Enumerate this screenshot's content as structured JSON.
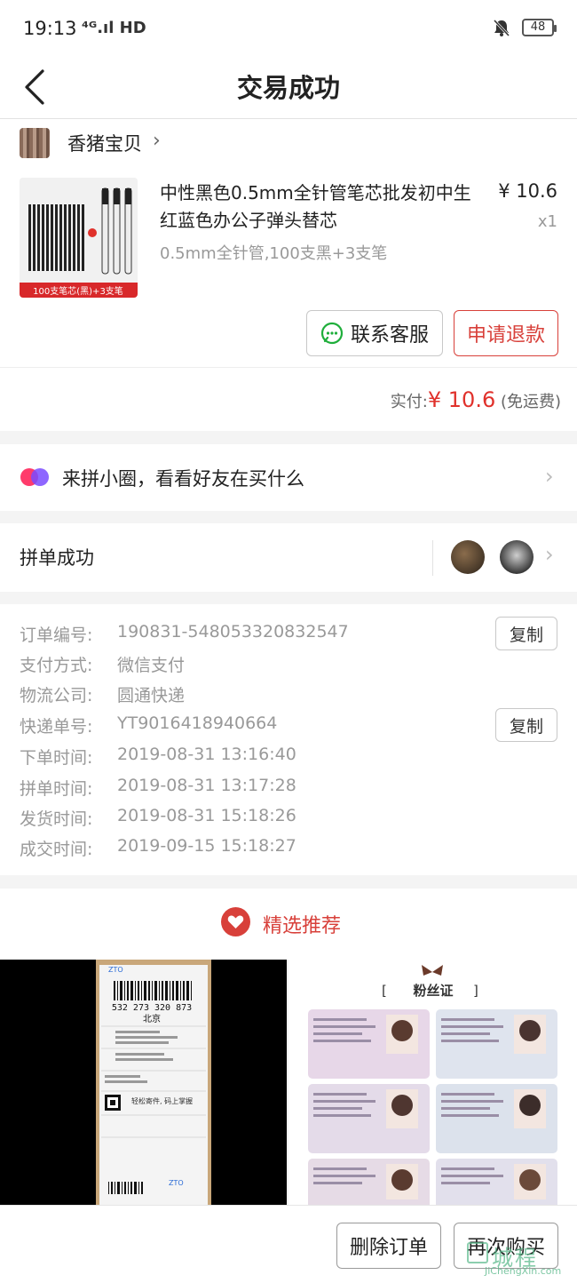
{
  "status_bar": {
    "time": "19:13",
    "signal": "⁴ᴳ.ıl HD",
    "battery": "48"
  },
  "nav": {
    "title": "交易成功"
  },
  "shop": {
    "name": "香猪宝贝"
  },
  "product": {
    "title": "中性黑色0.5mm全针管笔芯批发初中生红蓝色办公子弹头替芯",
    "spec": "0.5mm全针管,100支黑+3支笔",
    "price": "¥ 10.6",
    "qty": "x1",
    "image_caption": "100支笔芯(黑)+3支笔"
  },
  "actions": {
    "contact": "联系客服",
    "refund": "申请退款"
  },
  "payment": {
    "label": "实付:",
    "amount": "¥ 10.6",
    "note": "(免运费)"
  },
  "circle": {
    "text": "来拼小圈，看看好友在买什么"
  },
  "group": {
    "text": "拼单成功"
  },
  "order_info": {
    "rows": [
      {
        "label": "订单编号:",
        "value": "190831-548053320832547"
      },
      {
        "label": "支付方式:",
        "value": "微信支付"
      },
      {
        "label": "物流公司:",
        "value": "圆通快递"
      },
      {
        "label": "快递单号:",
        "value": "YT9016418940664"
      },
      {
        "label": "下单时间:",
        "value": "2019-08-31 13:16:40"
      },
      {
        "label": "拼单时间:",
        "value": "2019-08-31 13:17:28"
      },
      {
        "label": "发货时间:",
        "value": "2019-08-31 15:18:26"
      },
      {
        "label": "成交时间:",
        "value": "2019-09-15 15:18:27"
      }
    ],
    "copy_label": "复制"
  },
  "recommend": {
    "title": "精选推荐",
    "left_item": {
      "tracking": "532 273 320 873",
      "city": "北京",
      "slogan": "轻松寄件, 码上掌握"
    },
    "right_item": {
      "heading": "粉丝证"
    }
  },
  "bottom": {
    "delete": "删除订单",
    "rebuy": "再次购买"
  },
  "watermark": {
    "cn": "城程",
    "en": "JiChengXin.com"
  },
  "colors": {
    "accent": "#d8403a",
    "price_red": "#e0312b",
    "watermark": "#5bb98b"
  }
}
